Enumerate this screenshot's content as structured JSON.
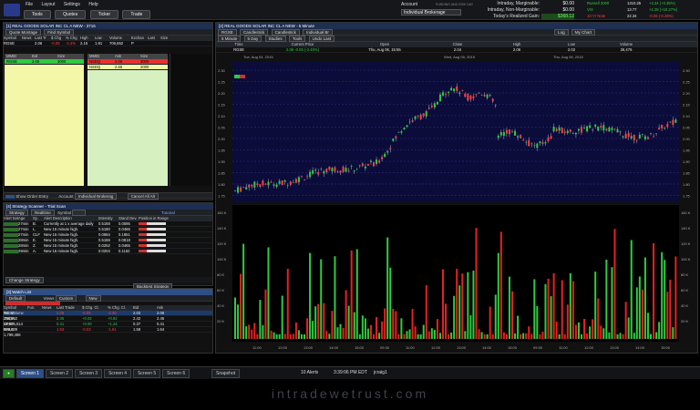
{
  "menu": {
    "items": [
      "File",
      "Layout",
      "Settings",
      "Help"
    ],
    "tabs": [
      "Tools",
      "Quotes",
      "Ticker",
      "Trade"
    ]
  },
  "account": {
    "label": "Account",
    "value": "Individual Brokerage",
    "header_note": "FUNDING AND RISK DAY",
    "rows": [
      {
        "label": "Intraday, Marginable:",
        "value": "$0.00"
      },
      {
        "label": "Intraday, Non-Marginable:",
        "value": "$0.00"
      },
      {
        "label": "Today's Realized Gain:",
        "value": "$0.00"
      }
    ],
    "small": [
      {
        "v": "$0.00"
      },
      {
        "v": "$0.00"
      },
      {
        "v": "$368.12"
      }
    ]
  },
  "indices": [
    {
      "name": "Russell 2000",
      "value": "1210.25",
      "chg": "+4.24 (+0.35%)"
    },
    {
      "name": "VIX",
      "value": "13.77",
      "chg": "+1.28 (+10.27%)"
    },
    {
      "name": "10-Yr Note",
      "value": "22.34",
      "chg": "-0.06 (-0.26%)"
    }
  ],
  "colors": {
    "accent": "#1d2f52",
    "up": "#2ecc40",
    "down": "#ff4040"
  },
  "level2": {
    "title": "[1] REAL GOODS SOLAR INC CL A NEW - 3716",
    "toolbar": [
      "Quote Montage",
      "Find Symbol"
    ],
    "headers": [
      "Symbol",
      "News",
      "Last Tr",
      "$ Chg",
      "% Chg",
      "High",
      "Low",
      "Volume",
      "Exchan",
      "Last",
      "Size"
    ],
    "quote": [
      "RGSE",
      "",
      "2.06",
      "-0.05",
      "-2.4%",
      "2.15",
      "1.91",
      "706,652",
      "P",
      "",
      ""
    ],
    "bid_hdr": [
      "MMID",
      "Bid",
      "Size"
    ],
    "ask_hdr": [
      "MMID",
      "Ask",
      "Size"
    ],
    "bids": [
      [
        "RGSE",
        "2.05",
        "3000"
      ]
    ],
    "asks": [
      [
        "NSDQ",
        "2.05",
        "3000"
      ],
      [
        "NSDQ",
        "2.55",
        "2000"
      ]
    ],
    "footer": {
      "show": "Show Order Entry",
      "account_label": "Account",
      "account": "Individual Brokerag",
      "cancel": "Cancel All Alt"
    }
  },
  "chart": {
    "title": "[2] REAL GOODS SOLAR INC CL A NEW - 5 Minute",
    "toolbar": [
      "RGSE",
      "Candlestick",
      "Candlestick",
      "Individual Br",
      "Log",
      "My Chart"
    ],
    "toolbar2": [
      "5 Minute",
      "5 Day",
      "Studies",
      "Tools",
      "Undo Last"
    ],
    "info_headers": [
      "Time",
      "Current Price",
      "Open",
      "Close",
      "High",
      "Low",
      "Volume"
    ],
    "info_values": [
      "RGSE",
      "2.06  -0.05 (-2.40%)",
      "Thu, Aug 06, 15:55",
      "2.04",
      "2.06",
      "2.02",
      "26,476"
    ],
    "dates": [
      "Tue, Aug 04, 2015",
      "Wed, Aug 05, 2015",
      "Thu, Aug 06, 2015"
    ],
    "y_labels": [
      "2.30",
      "2.25",
      "2.20",
      "2.15",
      "2.10",
      "2.05",
      "2.00",
      "1.95",
      "1.90",
      "1.85",
      "1.80",
      "1.75"
    ],
    "vol_labels": [
      "160 K",
      "140 K",
      "120 K",
      "100 K",
      "80 K",
      "60 K",
      "40 K",
      "20 K"
    ],
    "x_labels": [
      "11:00",
      "12:00",
      "13:00",
      "14:00",
      "15:00",
      "09:30",
      "11:00",
      "12:00",
      "13:00",
      "14:00",
      "15:00",
      "09:30",
      "11:00",
      "12:00",
      "13:00",
      "14:00",
      "15:00"
    ]
  },
  "scanner": {
    "title": "[4] Strategy Scanner - Trial Scan",
    "toolbar": [
      "Strategy",
      "Realtime",
      "Symbol",
      "Tutorial"
    ],
    "headers": [
      "Alert Set",
      "Age",
      "Sy.",
      "Alert Description",
      "Intensity",
      "Stand Dev.",
      "Position in Range"
    ],
    "rows": [
      [
        "",
        "27min",
        "B.",
        "Currently at 1 x average daily",
        "0.5168",
        "0.0595"
      ],
      [
        "",
        "27min",
        "L.",
        "New 15 minute high.",
        "0.5180",
        "0.0466"
      ],
      [
        "",
        "27min",
        "CLF",
        "New 15 minute high.",
        "0.0684",
        "0.1851"
      ],
      [
        "",
        "28min",
        "E.",
        "New 15 minute high.",
        "0.5166",
        "0.0818"
      ],
      [
        "",
        "28min",
        "Z.",
        "New 15 minute high.",
        "0.0252",
        "0.0465"
      ],
      [
        "",
        "29min",
        "A.",
        "New 15 minute high.",
        "0.0204",
        "0.1162"
      ]
    ],
    "footer": [
      "Change Strategy",
      "Backtest Strategy"
    ]
  },
  "watch": {
    "title": "[3] Watch List",
    "list_label": "Default",
    "views_label": "Views",
    "view": "Custom",
    "new": "New",
    "headers": [
      "Symbol",
      "Fun.",
      "News",
      "Last Trade",
      "$ Chg. Cl.",
      "% Chg. Cl.",
      "Bid",
      "Ask",
      "Tot. Volume"
    ],
    "rows": [
      [
        "RGSE",
        "",
        "",
        "2.06",
        "-0.05",
        "-2.40",
        "2.02",
        "2.06",
        "706,652"
      ],
      [
        "ZNGA",
        "",
        "",
        "2.45",
        "+0.02",
        "+0.82",
        "2.42",
        "2.45",
        "18,605,514"
      ],
      [
        "CPST",
        "",
        "",
        "0.41",
        "+0.00",
        "+1.24",
        "0.37",
        "0.41",
        "999,039"
      ],
      [
        "GALE",
        "",
        "",
        "1.63",
        "-0.03",
        "-1.81",
        "1.58",
        "1.64",
        "1,799,486"
      ]
    ]
  },
  "screens": [
    "Screen 1",
    "Screen 2",
    "Screen 3",
    "Screen 4",
    "Screen 5",
    "Screen 6"
  ],
  "status": {
    "alerts": "10 Alerts",
    "time": "3:39:06 PM EDT",
    "user": "jcraig1",
    "snapshot": "Snapshot"
  },
  "watermark": "intradewetrust.com"
}
